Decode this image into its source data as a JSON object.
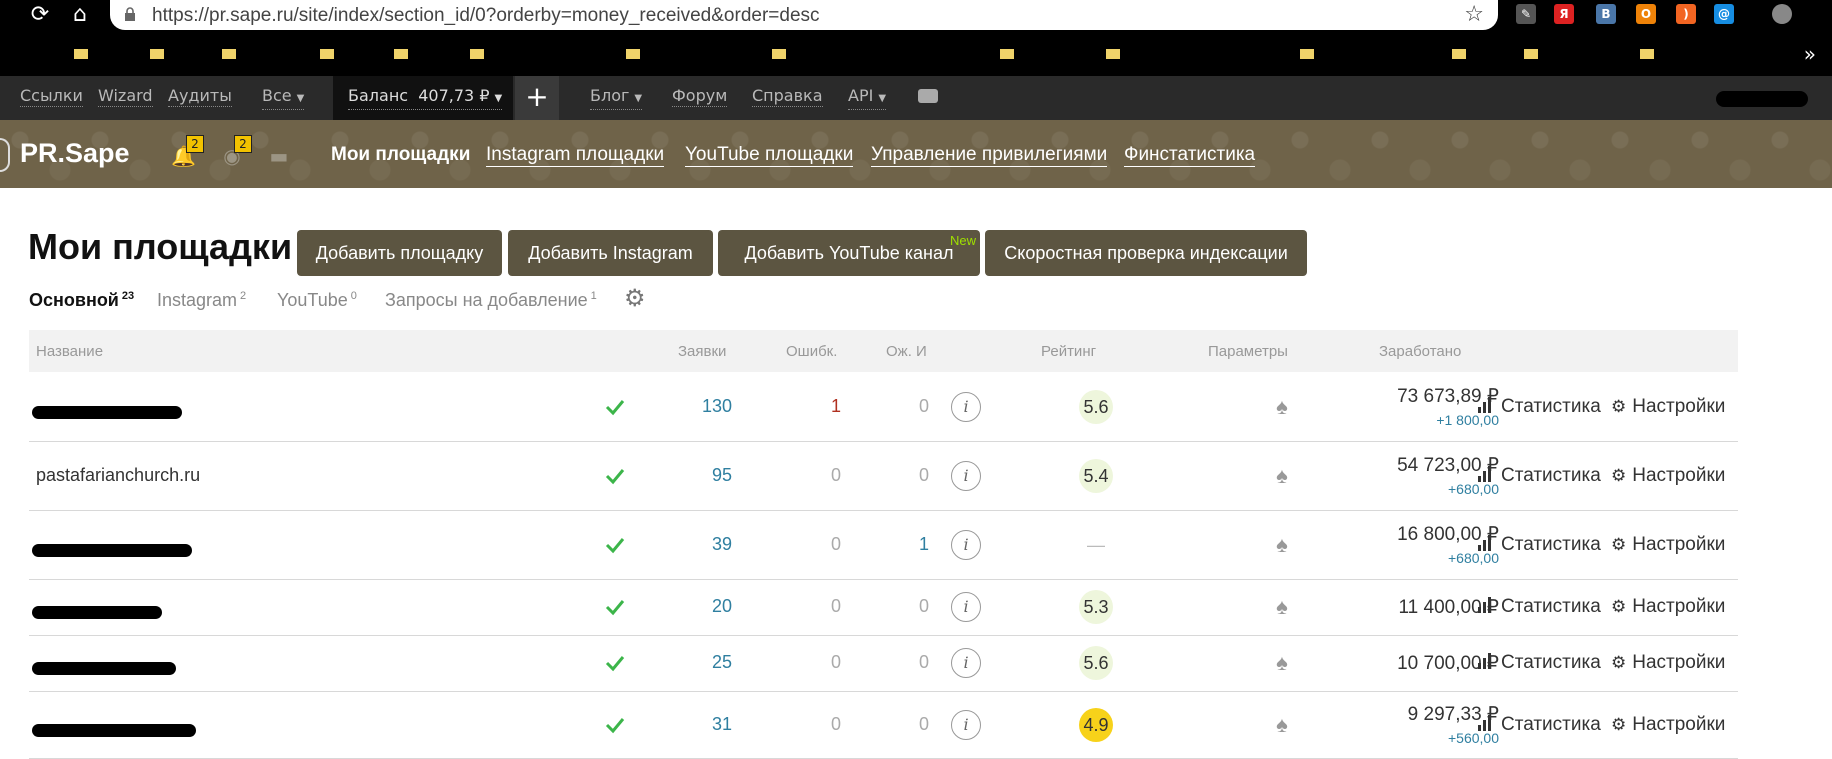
{
  "browser": {
    "url": "https://pr.sape.ru/site/index/section_id/0?orderby=money_received&order=desc"
  },
  "topnav": {
    "links": [
      "Ссылки",
      "Wizard",
      "Аудиты"
    ],
    "filter": "Все",
    "balance_label": "Баланс",
    "balance_value": "407,73 ₽",
    "plus": "+",
    "blog": "Блог",
    "forum": "Форум",
    "help": "Справка",
    "api": "API"
  },
  "header": {
    "logo": "PR.Sape",
    "notifications_count": "2",
    "views_count": "2",
    "nav": [
      "Мои площадки",
      "Instagram площадки",
      "YouTube площадки",
      "Управление привилегиями",
      "Финстатистика"
    ]
  },
  "page": {
    "title": "Мои площадки",
    "buttons": [
      "Добавить площадку",
      "Добавить Instagram",
      "Добавить YouTube канал",
      "Скоростная проверка индексации"
    ],
    "new_badge": "New"
  },
  "subtabs": [
    {
      "label": "Основной",
      "count": "23"
    },
    {
      "label": "Instagram",
      "count": "2"
    },
    {
      "label": "YouTube",
      "count": "0"
    },
    {
      "label": "Запросы на добавление",
      "count": "1"
    }
  ],
  "table": {
    "headers": {
      "name": "Название",
      "requests": "Заявки",
      "errors": "Ошибк.",
      "pending": "Ож. И",
      "rating": "Рейтинг",
      "params": "Параметры",
      "earned": "Заработано"
    },
    "stat_label": "Статистика",
    "settings_label": "Настройки",
    "rows": [
      {
        "name": "",
        "requests": "130",
        "errors": "1",
        "pending": "0",
        "rating": "5.6",
        "earned": "73 673,89 ₽",
        "delta": "+1 800,00"
      },
      {
        "name": "pastafarianchurch.ru",
        "requests": "95",
        "errors": "0",
        "pending": "0",
        "rating": "5.4",
        "earned": "54 723,00 ₽",
        "delta": "+680,00"
      },
      {
        "name": "",
        "requests": "39",
        "errors": "0",
        "pending": "1",
        "rating": "—",
        "earned": "16 800,00 ₽",
        "delta": "+680,00"
      },
      {
        "name": "",
        "requests": "20",
        "errors": "0",
        "pending": "0",
        "rating": "5.3",
        "earned": "11 400,00 ₽",
        "delta": ""
      },
      {
        "name": "",
        "requests": "25",
        "errors": "0",
        "pending": "0",
        "rating": "5.6",
        "earned": "10 700,00 ₽",
        "delta": ""
      },
      {
        "name": "",
        "requests": "31",
        "errors": "0",
        "pending": "0",
        "rating": "4.9",
        "earned": "9 297,33 ₽",
        "delta": "+560,00"
      }
    ]
  },
  "colors": {
    "brand_bar": "#6f6349",
    "button": "#5c5541",
    "link_blue": "#2f7fa0",
    "check_green": "#3cb54a",
    "rating_low": "#f7d21a",
    "rating_normal": "#eef6dc"
  }
}
